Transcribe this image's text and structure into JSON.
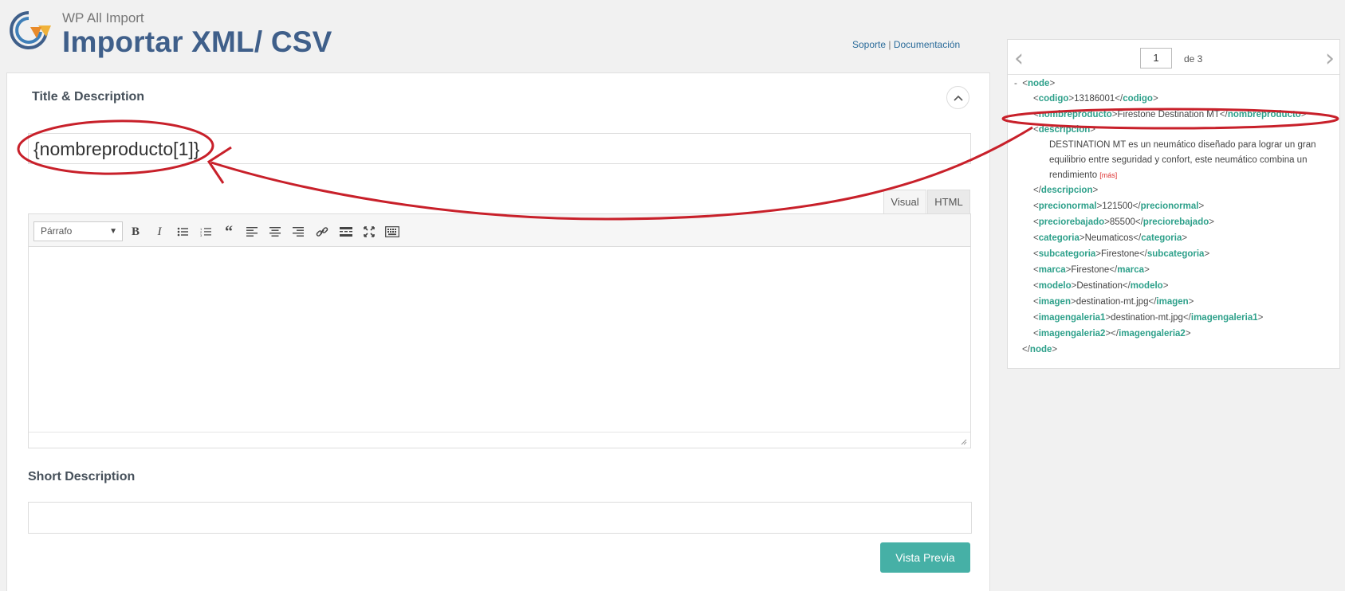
{
  "header": {
    "app_name": "WP All Import",
    "title": "Importar XML/ CSV",
    "support_link": "Soporte",
    "separator": "|",
    "docs_link": "Documentación"
  },
  "title_section": {
    "heading": "Title & Description",
    "title_value": "{nombreproducto[1]}"
  },
  "editor": {
    "tabs": [
      "Visual",
      "HTML"
    ],
    "format_select": "Párrafo",
    "toolbar_icons": [
      "bold-icon",
      "italic-icon",
      "bullet-list-icon",
      "numbered-list-icon",
      "blockquote-icon",
      "align-left-icon",
      "align-center-icon",
      "align-right-icon",
      "link-icon",
      "read-more-icon",
      "fullscreen-icon",
      "keyboard-icon"
    ]
  },
  "short_description": {
    "heading": "Short Description",
    "value": ""
  },
  "preview_button": "Vista Previa",
  "xml_panel": {
    "page": "1",
    "of_label": "de 3",
    "collapse_marker": "-",
    "nodes": {
      "node_open": "node",
      "codigo": {
        "tag": "codigo",
        "value": "13186001"
      },
      "nombreproducto": {
        "tag": "nombreproducto",
        "value": "Firestone Destination MT"
      },
      "descripcion_tag": "descripcion",
      "descripcion_text_1": "DESTINATION MT es un neumático diseñado para lograr un gran",
      "descripcion_text_2": "equilibrio entre seguridad y confort, este neumático combina un",
      "descripcion_text_3": "rendimiento",
      "more_label": "[más]",
      "precionormal": {
        "tag": "precionormal",
        "value": "121500"
      },
      "preciorebajado": {
        "tag": "preciorebajado",
        "value": "85500"
      },
      "categoria": {
        "tag": "categoria",
        "value": "Neumaticos"
      },
      "subcategoria": {
        "tag": "subcategoria",
        "value": "Firestone"
      },
      "marca": {
        "tag": "marca",
        "value": "Firestone"
      },
      "modelo": {
        "tag": "modelo",
        "value": "Destination"
      },
      "imagen": {
        "tag": "imagen",
        "value": "destination-mt.jpg"
      },
      "imagengaleria1": {
        "tag": "imagengaleria1",
        "value": "destination-mt.jpg"
      },
      "imagengaleria2": {
        "tag": "imagengaleria2",
        "value": ""
      }
    }
  },
  "colors": {
    "title": "#3f5f8a",
    "tag": "#2da08a",
    "button": "#46b0a6",
    "annotation": "#c8202a"
  }
}
